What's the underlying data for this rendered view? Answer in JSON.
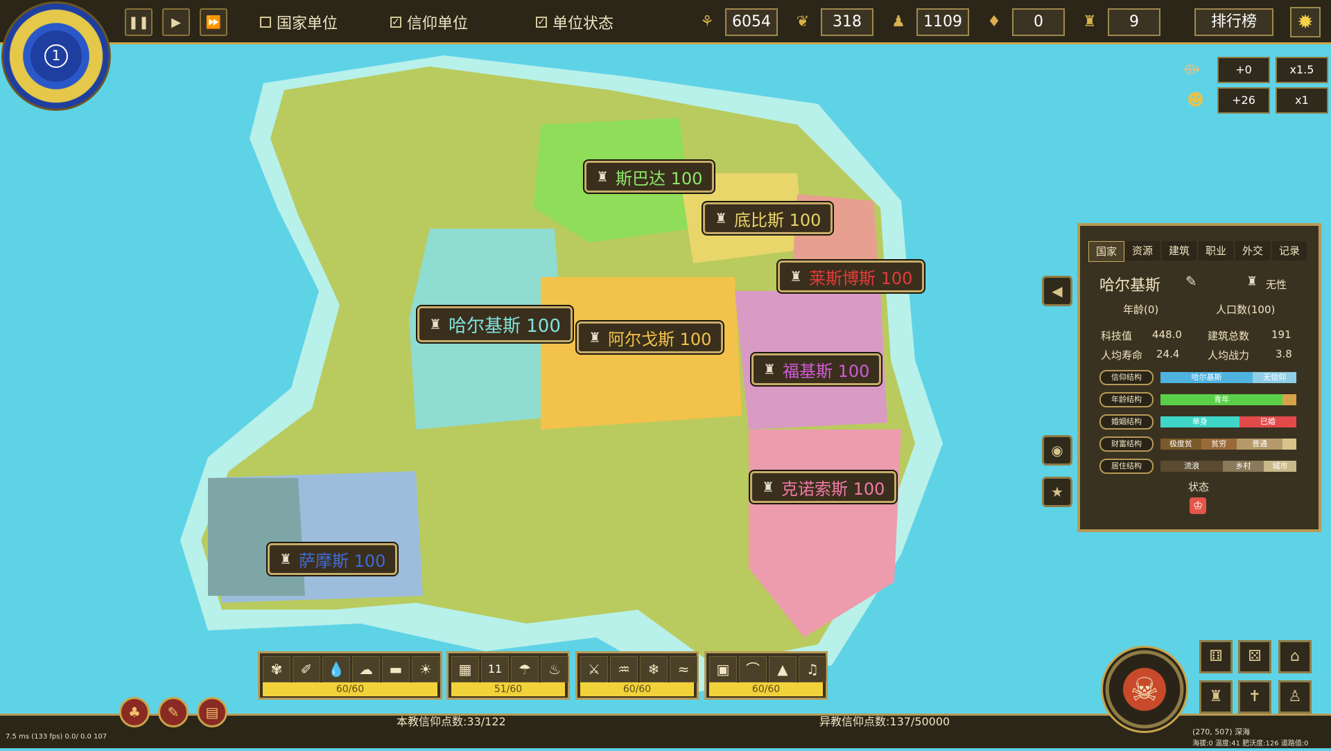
{
  "topbar": {
    "pause_label": "❚❚",
    "play_label": "▶",
    "fast_label": "⏩",
    "toggles": [
      {
        "label": "国家单位",
        "checked": false
      },
      {
        "label": "信仰单位",
        "checked": true
      },
      {
        "label": "单位状态",
        "checked": true
      }
    ],
    "resources": [
      {
        "icon": "wheat-icon",
        "glyph": "⚘",
        "value": "6054"
      },
      {
        "icon": "paw-icon",
        "glyph": "❦",
        "value": "318"
      },
      {
        "icon": "person-icon",
        "glyph": "♟",
        "value": "1109"
      },
      {
        "icon": "faith-flame-icon",
        "glyph": "♦",
        "value": "0"
      },
      {
        "icon": "tower-icon",
        "glyph": "♜",
        "value": "9"
      }
    ],
    "rank_label": "排行榜",
    "settings_glyph": "✹"
  },
  "compass": {
    "number": "1"
  },
  "multipliers": [
    {
      "value": "+0",
      "rate": "x1.5"
    },
    {
      "value": "+26",
      "rate": "x1"
    }
  ],
  "cities": [
    {
      "name": "斯巴达 100",
      "color": "#8ee86a"
    },
    {
      "name": "底比斯 100",
      "color": "#e9d36a"
    },
    {
      "name": "莱斯博斯 100",
      "color": "#e23b3b"
    },
    {
      "name": "哈尔基斯 100",
      "color": "#7fe3e0"
    },
    {
      "name": "阿尔戈斯 100",
      "color": "#f3c34a"
    },
    {
      "name": "福基斯 100",
      "color": "#d25bd9"
    },
    {
      "name": "克诺索斯 100",
      "color": "#f07aa8"
    },
    {
      "name": "萨摩斯 100",
      "color": "#3f6bd6"
    }
  ],
  "panel": {
    "tabs": [
      "国家",
      "资源",
      "建筑",
      "职业",
      "外交",
      "记录"
    ],
    "nation_name": "哈尔基斯",
    "religion": "无性",
    "age": "年龄(0)",
    "population": "人口数(100)",
    "tech_label": "科技值",
    "tech_value": "448.0",
    "buildings_label": "建筑总数",
    "buildings_value": "191",
    "lifespan_label": "人均寿命",
    "lifespan_value": "24.4",
    "combat_label": "人均战力",
    "combat_value": "3.8",
    "bars": [
      {
        "label": "信仰结构",
        "segments": [
          {
            "text": "哈尔基斯",
            "color": "#4fb3e0",
            "pct": 68
          },
          {
            "text": "无信仰",
            "color": "#8fcfe6",
            "pct": 32
          }
        ]
      },
      {
        "label": "年龄结构",
        "segments": [
          {
            "text": "青年",
            "color": "#5ad04a",
            "pct": 90
          },
          {
            "text": "",
            "color": "#d8a24a",
            "pct": 10
          }
        ]
      },
      {
        "label": "婚姻结构",
        "segments": [
          {
            "text": "单身",
            "color": "#3fd6c8",
            "pct": 58
          },
          {
            "text": "已婚",
            "color": "#e24a4a",
            "pct": 42
          }
        ]
      },
      {
        "label": "财富结构",
        "segments": [
          {
            "text": "极度贫",
            "color": "#7a5a2a",
            "pct": 30
          },
          {
            "text": "贫穷",
            "color": "#9a6a3a",
            "pct": 26
          },
          {
            "text": "普通",
            "color": "#b49a6a",
            "pct": 34
          },
          {
            "text": "",
            "color": "#d8c48a",
            "pct": 10
          }
        ]
      },
      {
        "label": "居住结构",
        "segments": [
          {
            "text": "流浪",
            "color": "#5a4a30",
            "pct": 46
          },
          {
            "text": "乡村",
            "color": "#8a7a5a",
            "pct": 30
          },
          {
            "text": "城市",
            "color": "#c9b88a",
            "pct": 24
          }
        ]
      }
    ],
    "status_label": "状态"
  },
  "toolbar": {
    "groups": [
      {
        "tools": [
          "✾",
          "✐",
          "💧",
          "☁",
          "▬",
          "☀"
        ],
        "count": "60/60"
      },
      {
        "tools": [
          "▦",
          "11",
          "☂",
          "♨"
        ],
        "count": "51/60"
      },
      {
        "tools": [
          "⚔",
          "♒",
          "❄",
          "≈"
        ],
        "count": "60/60"
      },
      {
        "tools": [
          "▣",
          "⌒",
          "▲",
          "♫"
        ],
        "count": "60/60"
      }
    ]
  },
  "bottom": {
    "own_faith": "本教信仰点数:33/122",
    "other_faith": "异教信仰点数:137/50000",
    "fps": "7.5 ms (133 fps) 0.0/ 0.0 107",
    "coords": "(270, 507) 深海",
    "terrain": "海拔:0 温度:41 肥沃度:126 道路值:0"
  }
}
